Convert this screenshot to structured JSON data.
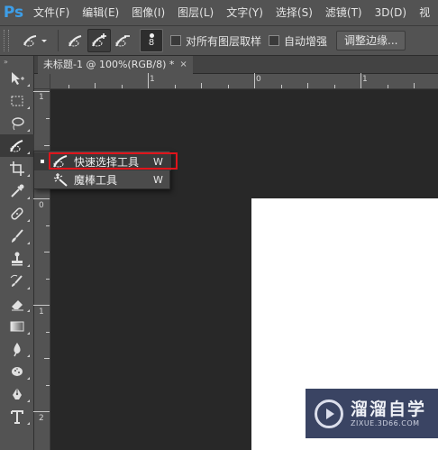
{
  "app": {
    "logo": "Ps"
  },
  "menu": [
    "文件(F)",
    "编辑(E)",
    "图像(I)",
    "图层(L)",
    "文字(Y)",
    "选择(S)",
    "滤镜(T)",
    "3D(D)",
    "视"
  ],
  "options": {
    "brush_size": "8",
    "sample_all_layers": "对所有图层取样",
    "auto_enhance": "自动增强",
    "refine_edge": "调整边缘..."
  },
  "document_tab": {
    "title": "未标题-1 @ 100%(RGB/8) *",
    "close": "×"
  },
  "rulers": {
    "horizontal": [
      "1",
      "0",
      "1"
    ],
    "vertical": [
      "1",
      "0",
      "1",
      "2"
    ]
  },
  "flyout": {
    "items": [
      {
        "label": "快速选择工具",
        "shortcut": "W",
        "icon": "quick-selection-icon",
        "selected": true
      },
      {
        "label": "魔棒工具",
        "shortcut": "W",
        "icon": "magic-wand-icon",
        "selected": false
      }
    ]
  },
  "watermark": {
    "title": "溜溜自学",
    "url": "ZIXUE.3D66.COM"
  },
  "toolbar_collapse": "»",
  "colors": {
    "highlight": "#e0141b",
    "panel": "#535353",
    "canvas_bg": "#282828",
    "ps_blue": "#3d9ee8"
  }
}
